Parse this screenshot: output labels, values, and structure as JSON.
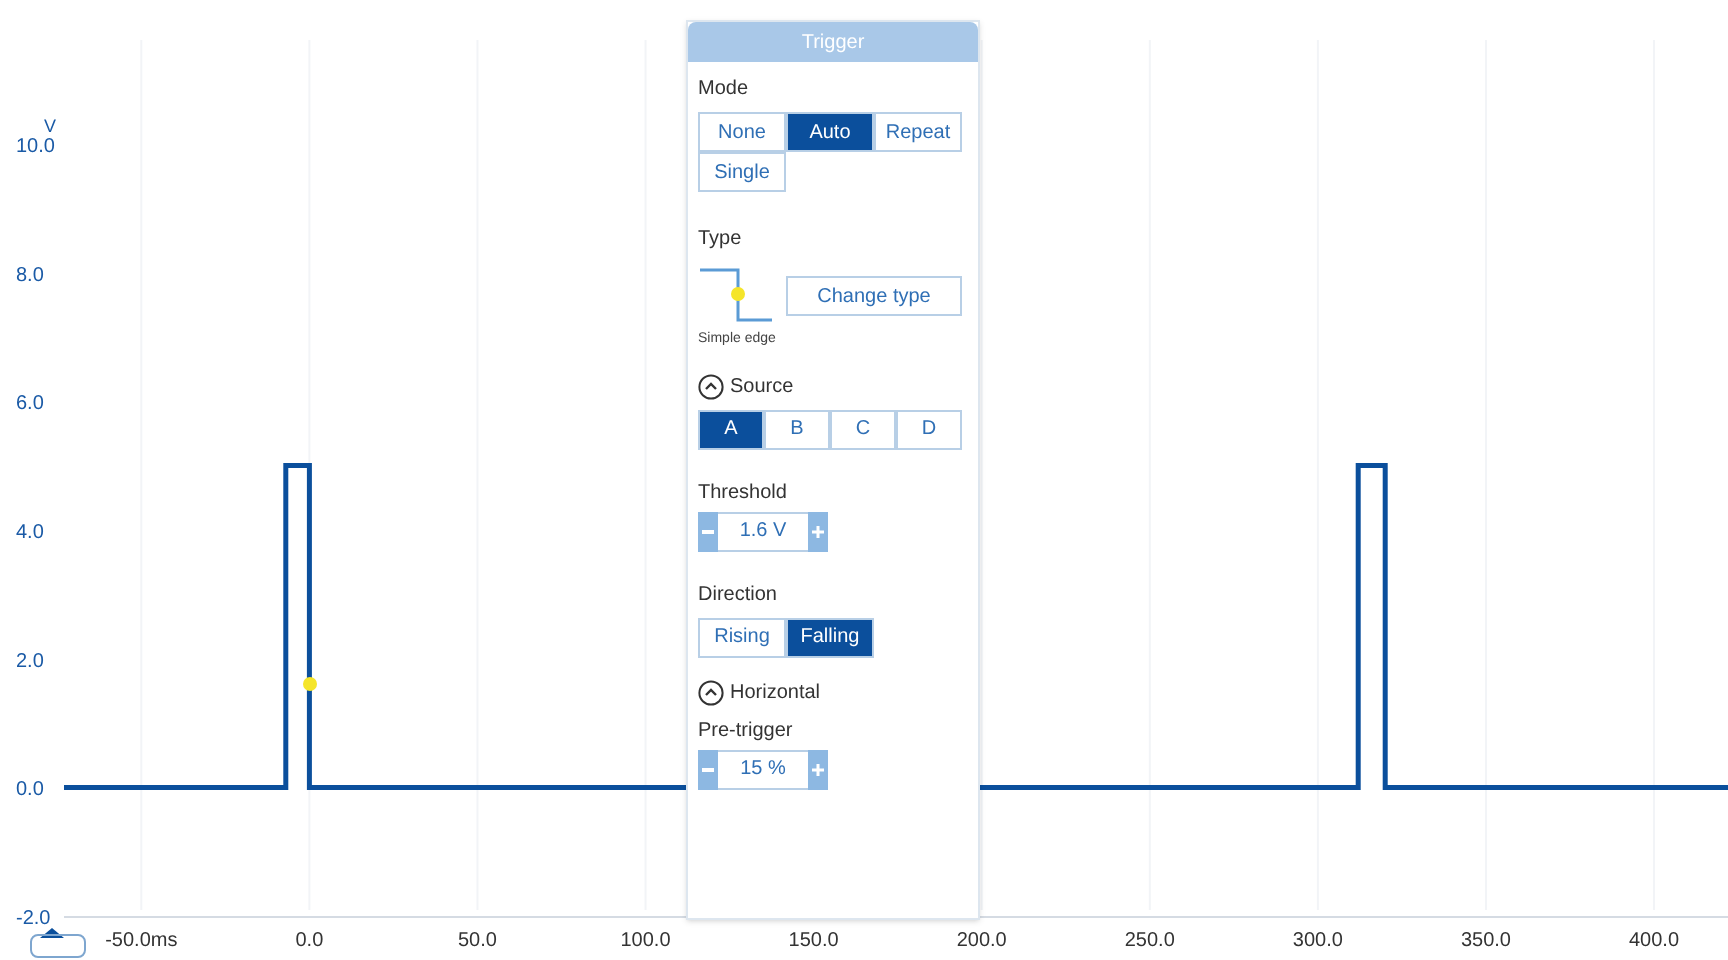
{
  "chart_data": {
    "type": "line",
    "ylabel": "V",
    "xlim": [
      -73,
      422
    ],
    "ylim": [
      -2.0,
      10.0
    ],
    "grid": true,
    "xticks": [
      {
        "value": -50,
        "label": "-50.0ms"
      },
      {
        "value": 0,
        "label": "0.0"
      },
      {
        "value": 50,
        "label": "50.0"
      },
      {
        "value": 100,
        "label": "100.0"
      },
      {
        "value": 150,
        "label": "150.0"
      },
      {
        "value": 200,
        "label": "200.0"
      },
      {
        "value": 250,
        "label": "250.0"
      },
      {
        "value": 300,
        "label": "300.0"
      },
      {
        "value": 350,
        "label": "350.0"
      },
      {
        "value": 400,
        "label": "400.0"
      }
    ],
    "yticks": [
      {
        "value": 10,
        "label": "10.0"
      },
      {
        "value": 8,
        "label": "8.0"
      },
      {
        "value": 6,
        "label": "6.0"
      },
      {
        "value": 4,
        "label": "4.0"
      },
      {
        "value": 2,
        "label": "2.0"
      },
      {
        "value": 0,
        "label": "0.0"
      },
      {
        "value": -2,
        "label": "-2.0"
      }
    ],
    "x": [
      -73,
      -7,
      -7,
      0,
      0,
      312,
      312,
      320,
      320,
      422
    ],
    "series": [
      {
        "color": "#0b4f9c",
        "values": [
          0,
          0,
          5,
          5,
          0,
          0,
          5,
          5,
          0,
          0
        ]
      }
    ]
  },
  "trigger_panel": {
    "title": "Trigger",
    "mode": {
      "label": "Mode",
      "options": [
        {
          "label": "None",
          "selected": false
        },
        {
          "label": "Auto",
          "selected": true
        },
        {
          "label": "Repeat",
          "selected": false
        },
        {
          "label": "Single",
          "selected": false
        }
      ]
    },
    "type": {
      "label": "Type",
      "caption": "Simple edge",
      "button": "Change type"
    },
    "source": {
      "label": "Source",
      "options": [
        {
          "label": "A",
          "selected": true
        },
        {
          "label": "B",
          "selected": false
        },
        {
          "label": "C",
          "selected": false
        },
        {
          "label": "D",
          "selected": false
        }
      ]
    },
    "threshold": {
      "label": "Threshold",
      "value": "1.6 V"
    },
    "direction": {
      "label": "Direction",
      "options": [
        {
          "label": "Rising",
          "selected": false
        },
        {
          "label": "Falling",
          "selected": true
        }
      ]
    },
    "horizontal": {
      "label": "Horizontal"
    },
    "pre_trigger": {
      "label": "Pre-trigger",
      "value": "15 %"
    }
  }
}
